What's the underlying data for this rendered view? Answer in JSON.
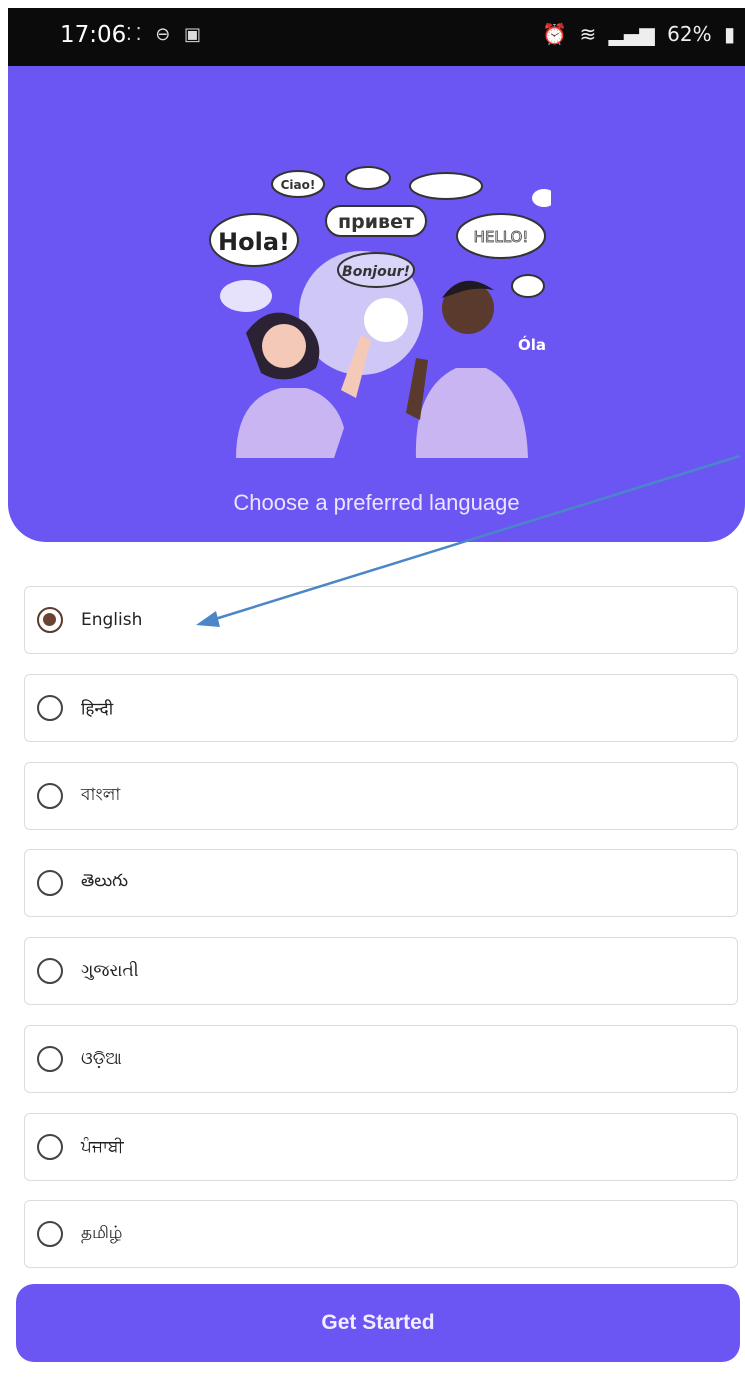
{
  "status_bar": {
    "time": "17:06",
    "left_icons": [
      "grid-dots-icon",
      "do-not-disturb-icon",
      "message-icon"
    ],
    "right_icons": [
      "alarm-icon",
      "wifi-icon",
      "volte-signal-icon",
      "battery-icon"
    ],
    "battery": "62%"
  },
  "hero": {
    "title": "Choose a preferred language",
    "background": "#6b56f4",
    "bubbles": [
      "Ciao!",
      "привет",
      "Hola!",
      "HELLO!",
      "Bonjour!",
      "Óla"
    ]
  },
  "languages": {
    "selected": "English",
    "options": [
      {
        "label": "English",
        "checked": true
      },
      {
        "label": "हिन्दी",
        "checked": false
      },
      {
        "label": "বাংলা",
        "checked": false
      },
      {
        "label": "తెలుగు",
        "checked": false
      },
      {
        "label": "ગુજરાતી",
        "checked": false
      },
      {
        "label": "ଓଡ଼ିଆ",
        "checked": false
      },
      {
        "label": "ਪੰਜਾਬੀ",
        "checked": false
      },
      {
        "label": "தமிழ்",
        "checked": false
      }
    ]
  },
  "actions": {
    "get_started": "Get Started"
  },
  "annotation": {
    "arrow_color": "#4a86c8"
  }
}
